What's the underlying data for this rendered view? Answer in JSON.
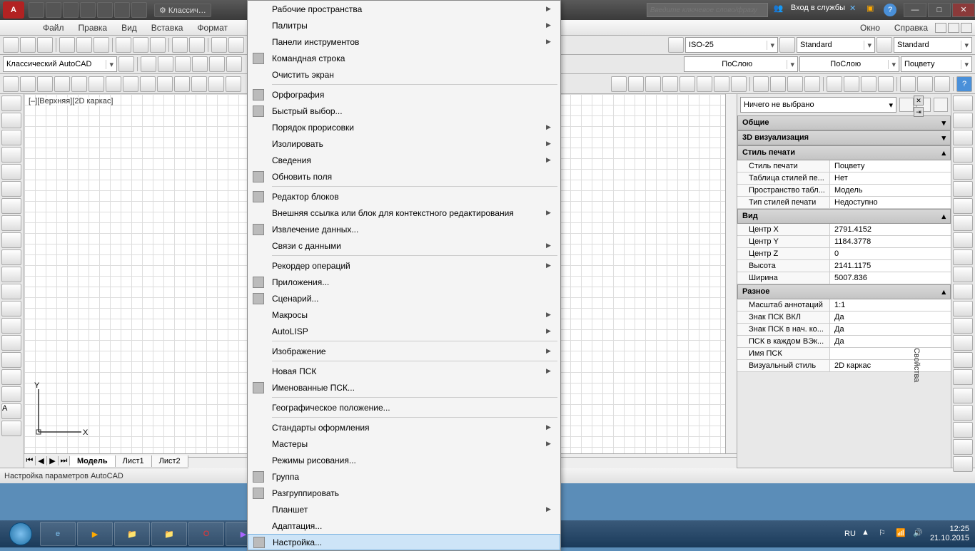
{
  "titlebar": {
    "logo": "A",
    "workspace": "⚙ Классич…",
    "search_placeholder": "Введите ключевое слово/фразу",
    "signin": "Вход в службы"
  },
  "menubar": {
    "items": [
      "Файл",
      "Правка",
      "Вид",
      "Вставка",
      "Формат",
      "",
      "Окно",
      "Справка"
    ]
  },
  "toolbar2": {
    "workspace_combo": "Классический AutoCAD",
    "dimstyle": "ISO-25",
    "tablestyle": "Standard",
    "textstyle": "Standard"
  },
  "toolbar3": {
    "layer": "ПоСлою",
    "linetype": "ПоСлою",
    "color": "Поцвету"
  },
  "canvas": {
    "viewlabel": "[–][Верхняя][2D каркас]",
    "tabs": {
      "model": "Модель",
      "sheet1": "Лист1",
      "sheet2": "Лист2"
    }
  },
  "menu": {
    "items": [
      {
        "label": "Рабочие пространства",
        "sub": true,
        "sep": false
      },
      {
        "label": "Палитры",
        "sub": true,
        "sep": false
      },
      {
        "label": "Панели инструментов",
        "sub": true,
        "sep": false
      },
      {
        "label": "Командная строка",
        "sub": false,
        "sep": false,
        "icon": true
      },
      {
        "label": "Очистить экран",
        "sub": false,
        "sep": true
      },
      {
        "label": "Орфография",
        "sub": false,
        "sep": false,
        "icon": true
      },
      {
        "label": "Быстрый выбор...",
        "sub": false,
        "sep": false,
        "icon": true
      },
      {
        "label": "Порядок прорисовки",
        "sub": true,
        "sep": false
      },
      {
        "label": "Изолировать",
        "sub": true,
        "sep": false
      },
      {
        "label": "Сведения",
        "sub": true,
        "sep": false
      },
      {
        "label": "Обновить поля",
        "sub": false,
        "sep": true,
        "icon": true
      },
      {
        "label": "Редактор блоков",
        "sub": false,
        "sep": false,
        "icon": true
      },
      {
        "label": "Внешняя ссылка или блок для контекстного редактирования",
        "sub": true,
        "sep": false
      },
      {
        "label": "Извлечение данных...",
        "sub": false,
        "sep": false,
        "icon": true
      },
      {
        "label": "Связи с данными",
        "sub": true,
        "sep": true
      },
      {
        "label": "Рекордер операций",
        "sub": true,
        "sep": false
      },
      {
        "label": "Приложения...",
        "sub": false,
        "sep": false,
        "icon": true
      },
      {
        "label": "Сценарий...",
        "sub": false,
        "sep": false,
        "icon": true
      },
      {
        "label": "Макросы",
        "sub": true,
        "sep": false
      },
      {
        "label": "AutoLISP",
        "sub": true,
        "sep": true
      },
      {
        "label": "Изображение",
        "sub": true,
        "sep": true
      },
      {
        "label": "Новая ПСК",
        "sub": true,
        "sep": false
      },
      {
        "label": "Именованные ПСК...",
        "sub": false,
        "sep": true,
        "icon": true
      },
      {
        "label": "Географическое положение...",
        "sub": false,
        "sep": true
      },
      {
        "label": "Стандарты оформления",
        "sub": true,
        "sep": false
      },
      {
        "label": "Мастеры",
        "sub": true,
        "sep": false
      },
      {
        "label": "Режимы рисования...",
        "sub": false,
        "sep": false
      },
      {
        "label": "Группа",
        "sub": false,
        "sep": false,
        "icon": true
      },
      {
        "label": "Разгруппировать",
        "sub": false,
        "sep": false,
        "icon": true
      },
      {
        "label": "Планшет",
        "sub": true,
        "sep": false
      },
      {
        "label": "Адаптация...",
        "sub": false,
        "sep": false
      },
      {
        "label": "Настройка...",
        "sub": false,
        "sep": false,
        "icon": true,
        "hl": true
      }
    ]
  },
  "properties": {
    "selector": "Ничего не выбрано",
    "sections": {
      "general": "Общие",
      "viz3d": "3D визуализация",
      "plotstyle": "Стиль печати",
      "view": "Вид",
      "misc": "Разное"
    },
    "plotstyle_rows": [
      {
        "k": "Стиль печати",
        "v": "Поцвету"
      },
      {
        "k": "Таблица стилей пе...",
        "v": "Нет"
      },
      {
        "k": "Пространство табл...",
        "v": "Модель"
      },
      {
        "k": "Тип стилей печати",
        "v": "Недоступно"
      }
    ],
    "view_rows": [
      {
        "k": "Центр X",
        "v": "2791.4152"
      },
      {
        "k": "Центр Y",
        "v": "1184.3778"
      },
      {
        "k": "Центр Z",
        "v": "0"
      },
      {
        "k": "Высота",
        "v": "2141.1175"
      },
      {
        "k": "Ширина",
        "v": "5007.836"
      }
    ],
    "misc_rows": [
      {
        "k": "Масштаб аннотаций",
        "v": "1:1"
      },
      {
        "k": "Знак ПСК ВКЛ",
        "v": "Да"
      },
      {
        "k": "Знак ПСК в нач. ко...",
        "v": "Да"
      },
      {
        "k": "ПСК в каждом ВЭк...",
        "v": "Да"
      },
      {
        "k": "Имя ПСК",
        "v": ""
      },
      {
        "k": "Визуальный стиль",
        "v": "2D каркас"
      }
    ],
    "panel_label": "Свойства"
  },
  "statusbar": {
    "text": "Настройка параметров AutoCAD"
  },
  "taskbar": {
    "lang": "RU",
    "time": "12:25",
    "date": "21.10.2015"
  }
}
